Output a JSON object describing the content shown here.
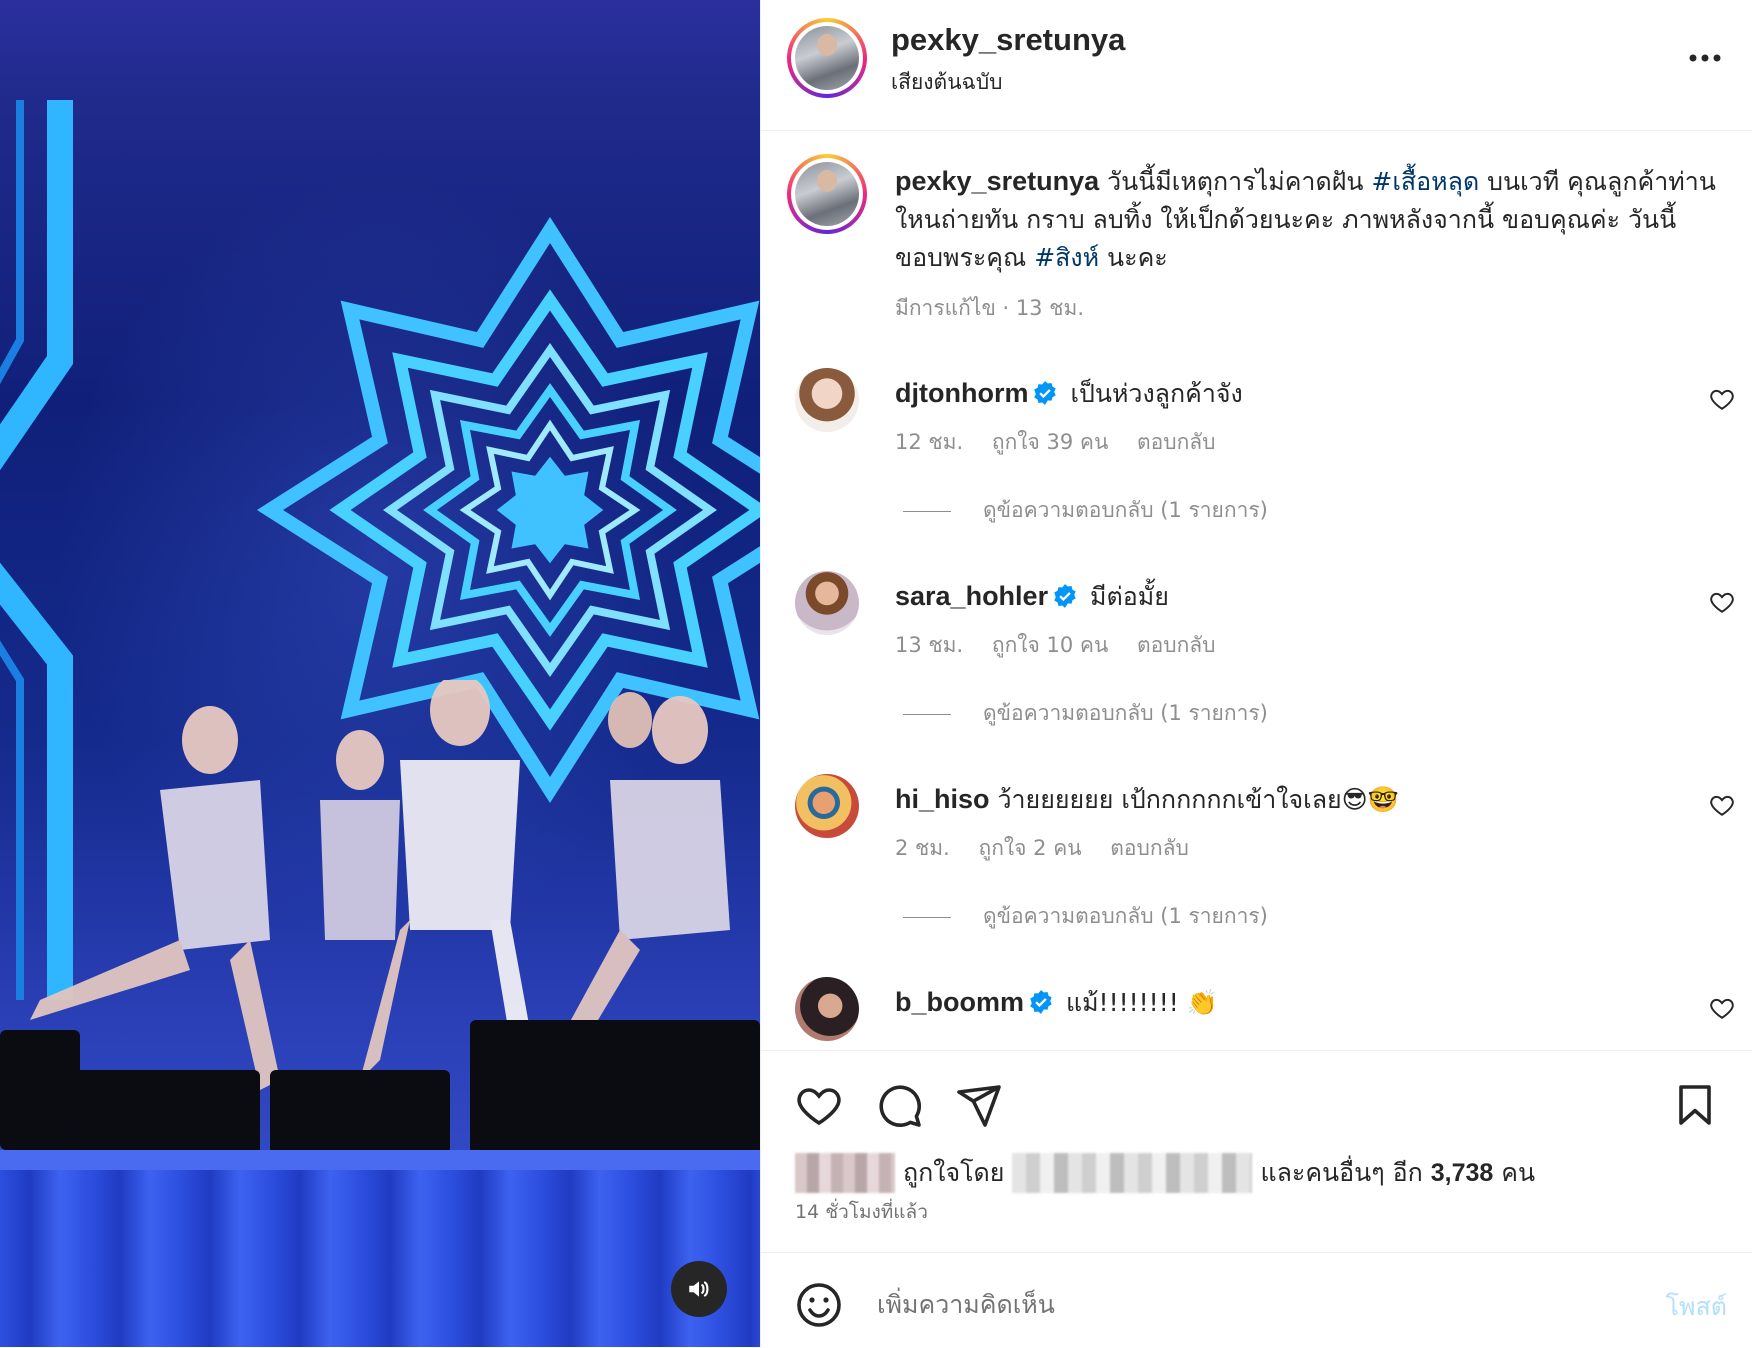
{
  "post": {
    "author": "pexky_sretunya",
    "audio_label": "เสียงต้นฉบับ",
    "caption_text_1": "วันนี้มีเหตุการไม่คาดฝัน",
    "caption_tag_1": "#เสื้อหลุด",
    "caption_text_2": "บนเวที คุณลูกค้าท่าน ใหนถ่ายทัน กราบ ลบทิ้ง ให้เป็กด้วยนะคะ ภาพหลังจากนี้ ขอบคุณค่ะ วันนี้ขอบพระคุณ",
    "caption_tag_2": "#สิงห์",
    "caption_text_3": "นะคะ",
    "edited_meta": "มีการแก้ไข · 13 ชม."
  },
  "comments": [
    {
      "user": "djtonhorm",
      "verified": true,
      "text": "เป็นห่วงลูกค้าจัง",
      "time": "12 ชม.",
      "likes": "ถูกใจ 39 คน",
      "reply": "ตอบกลับ",
      "view_replies": "ดูข้อความตอบกลับ (1 รายการ)"
    },
    {
      "user": "sara_hohler",
      "verified": true,
      "text": "มีต่อมั้ย",
      "time": "13 ชม.",
      "likes": "ถูกใจ 10 คน",
      "reply": "ตอบกลับ",
      "view_replies": "ดูข้อความตอบกลับ (1 รายการ)"
    },
    {
      "user": "hi_hiso",
      "verified": false,
      "text": "ว้ายยยยยย เป้กกกกกกเข้าใจเลย😎🤓",
      "time": "2 ชม.",
      "likes": "ถูกใจ 2 คน",
      "reply": "ตอบกลับ",
      "view_replies": "ดูข้อความตอบกลับ (1 รายการ)"
    },
    {
      "user": "b_boomm",
      "verified": true,
      "text": "แม้!!!!!!!! 👏",
      "time": "",
      "likes": "",
      "reply": "",
      "view_replies": ""
    }
  ],
  "likes": {
    "liked_by_label": "ถูกใจโดย",
    "and_others_label": "และคนอื่นๆ อีก",
    "count": "3,738",
    "unit": "คน"
  },
  "timestamp": "14 ชั่วโมงที่แล้ว",
  "composer": {
    "placeholder": "เพิ่มความคิดเห็น",
    "post_label": "โพสต์"
  },
  "colors": {
    "link": "#00376b",
    "meta": "#8e8e8e",
    "post_disabled": "#b2dffc",
    "verified": "#0095f6"
  },
  "icons": [
    "more-icon",
    "heart-icon",
    "comment-icon",
    "share-icon",
    "bookmark-icon",
    "emoji-icon",
    "volume-icon",
    "verified-icon"
  ]
}
